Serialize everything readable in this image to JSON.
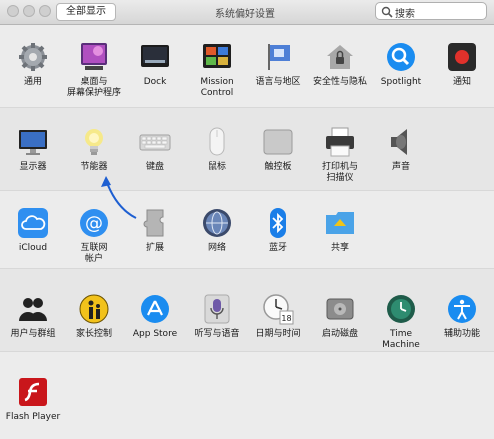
{
  "window": {
    "title": "系统偏好设置",
    "show_all_label": "全部显示",
    "back_symbol": "‹",
    "forward_symbol": "›"
  },
  "search": {
    "placeholder": "搜索"
  },
  "sections": {
    "personal": {
      "general": "通用",
      "desktop": "桌面与\n屏幕保护程序",
      "dock": "Dock",
      "mission": "Mission\nControl",
      "language": "语言与地区",
      "security": "安全性与隐私",
      "spotlight": "Spotlight",
      "notifications": "通知"
    },
    "hardware": {
      "displays": "显示器",
      "energy": "节能器",
      "keyboard": "键盘",
      "mouse": "鼠标",
      "trackpad": "触控板",
      "printers": "打印机与\n扫描仪",
      "sound": "声音"
    },
    "internet": {
      "icloud": "iCloud",
      "internet_accounts": "互联网\n帐户",
      "extensions": "扩展",
      "network": "网络",
      "bluetooth": "蓝牙",
      "sharing": "共享"
    },
    "system": {
      "users": "用户与群组",
      "parental": "家长控制",
      "appstore": "App Store",
      "dictation": "听写与语音",
      "datetime": "日期与时间",
      "startup": "启动磁盘",
      "timemachine": "Time Machine",
      "accessibility": "辅助功能"
    },
    "other": {
      "flash": "Flash Player"
    }
  },
  "calendar_day": "18",
  "colors": {
    "annotation_arrow": "#1e5fd1",
    "accent_blue": "#1a8cf0"
  }
}
